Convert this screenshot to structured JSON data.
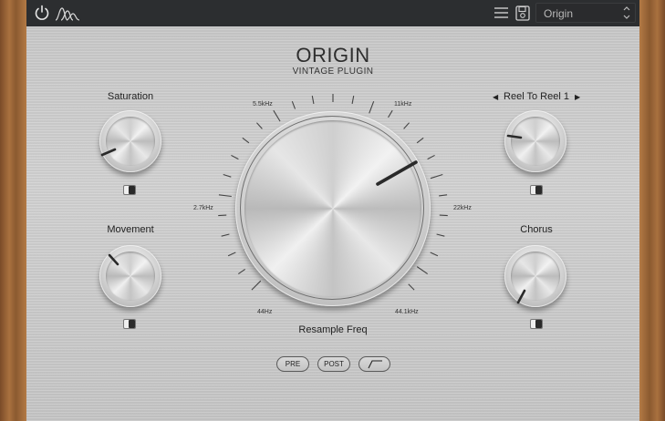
{
  "topbar": {
    "power_icon": "power-icon",
    "logo_icon": "waveform-logo-icon",
    "menu_icon": "hamburger-menu-icon",
    "save_icon": "save-icon",
    "preset": {
      "value": "Origin",
      "arrows_icon": "up-down-chevron-icon"
    }
  },
  "header": {
    "title": "ORIGIN",
    "subtitle": "VINTAGE PLUGIN"
  },
  "left": {
    "saturation": {
      "label": "Saturation"
    },
    "movement": {
      "label": "Movement"
    }
  },
  "right": {
    "tape": {
      "label": "Reel To Reel 1",
      "prev_icon": "triangle-left-icon",
      "next_icon": "triangle-right-icon"
    },
    "chorus": {
      "label": "Chorus"
    }
  },
  "main_knob": {
    "label": "Resample Freq",
    "ticks": [
      "5.5kHz",
      "11kHz",
      "2.7kHz",
      "22kHz",
      "44Hz",
      "44.1kHz"
    ]
  },
  "buttons": {
    "pre": "PRE",
    "post": "POST",
    "filter_icon": "filter-shape-icon"
  },
  "colors": {
    "topbar": "#2c2e30",
    "panel": "#cccccc",
    "wood": "#a06a3a",
    "indicator": "#2a2a2a"
  }
}
